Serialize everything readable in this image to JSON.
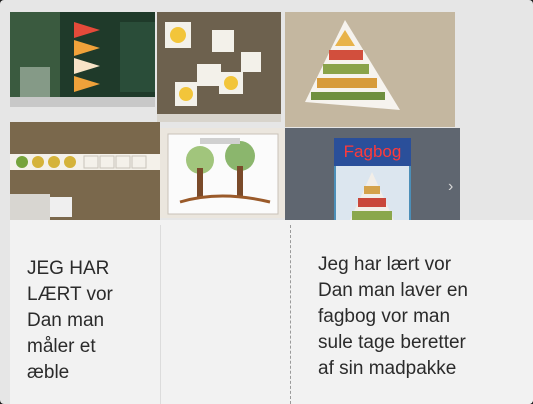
{
  "left_caption": {
    "lines": [
      "JEG HAR",
      "LÆRT vor",
      "Dan man",
      "måler et",
      "æble"
    ]
  },
  "right_caption": {
    "lines": [
      "Jeg har lært vor",
      "Dan man laver en",
      "fagbog vor man",
      "sule tage beretter",
      "af sin madpakke"
    ]
  },
  "book_cover": {
    "title": "Fagbog",
    "title_color": "#ff3a3a",
    "title_bg": "#2a4f9a"
  },
  "next_arrow": {
    "icon": "chevron-right-icon"
  }
}
